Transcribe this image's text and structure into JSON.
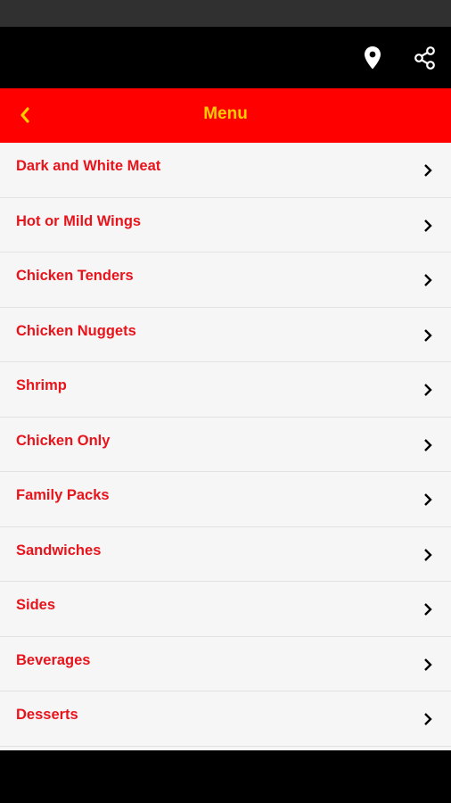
{
  "header": {
    "title": "Menu",
    "actions": {
      "location_icon": "map-pin-icon",
      "share_icon": "share-icon"
    },
    "back_icon": "chevron-left-icon"
  },
  "colors": {
    "title_bar": "#ff0000",
    "title_text": "#ffcc00",
    "item_text": "#e8141c",
    "app_bar": "#000000"
  },
  "menu": {
    "items": [
      {
        "label": "Dark and White Meat"
      },
      {
        "label": "Hot or Mild Wings"
      },
      {
        "label": "Chicken Tenders"
      },
      {
        "label": "Chicken Nuggets"
      },
      {
        "label": "Shrimp"
      },
      {
        "label": "Chicken Only"
      },
      {
        "label": "Family Packs"
      },
      {
        "label": "Sandwiches"
      },
      {
        "label": "Sides"
      },
      {
        "label": "Beverages"
      },
      {
        "label": "Desserts"
      }
    ]
  }
}
